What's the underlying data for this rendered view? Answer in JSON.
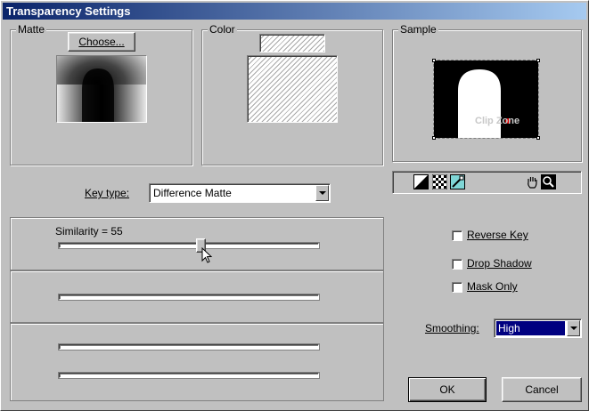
{
  "window": {
    "title": "Transparency Settings"
  },
  "matte": {
    "group_title": "Matte",
    "choose_button": "Choose..."
  },
  "color": {
    "group_title": "Color"
  },
  "sample": {
    "group_title": "Sample",
    "sample_text": "Clip Zone"
  },
  "key_type": {
    "label": "Key type:",
    "value": "Difference Matte"
  },
  "similarity": {
    "label": "Similarity = 55",
    "value": 55
  },
  "options": {
    "reverse_key": {
      "label": "Reverse Key",
      "checked": false
    },
    "drop_shadow": {
      "label": "Drop Shadow",
      "checked": false
    },
    "mask_only": {
      "label": "Mask Only",
      "checked": false
    }
  },
  "smoothing": {
    "label": "Smoothing:",
    "value": "High"
  },
  "buttons": {
    "ok": "OK",
    "cancel": "Cancel"
  },
  "colors": {
    "title_bar_start": "#0a246a",
    "title_bar_end": "#a6caf0",
    "face": "#c0c0c0",
    "selection": "#000080"
  }
}
